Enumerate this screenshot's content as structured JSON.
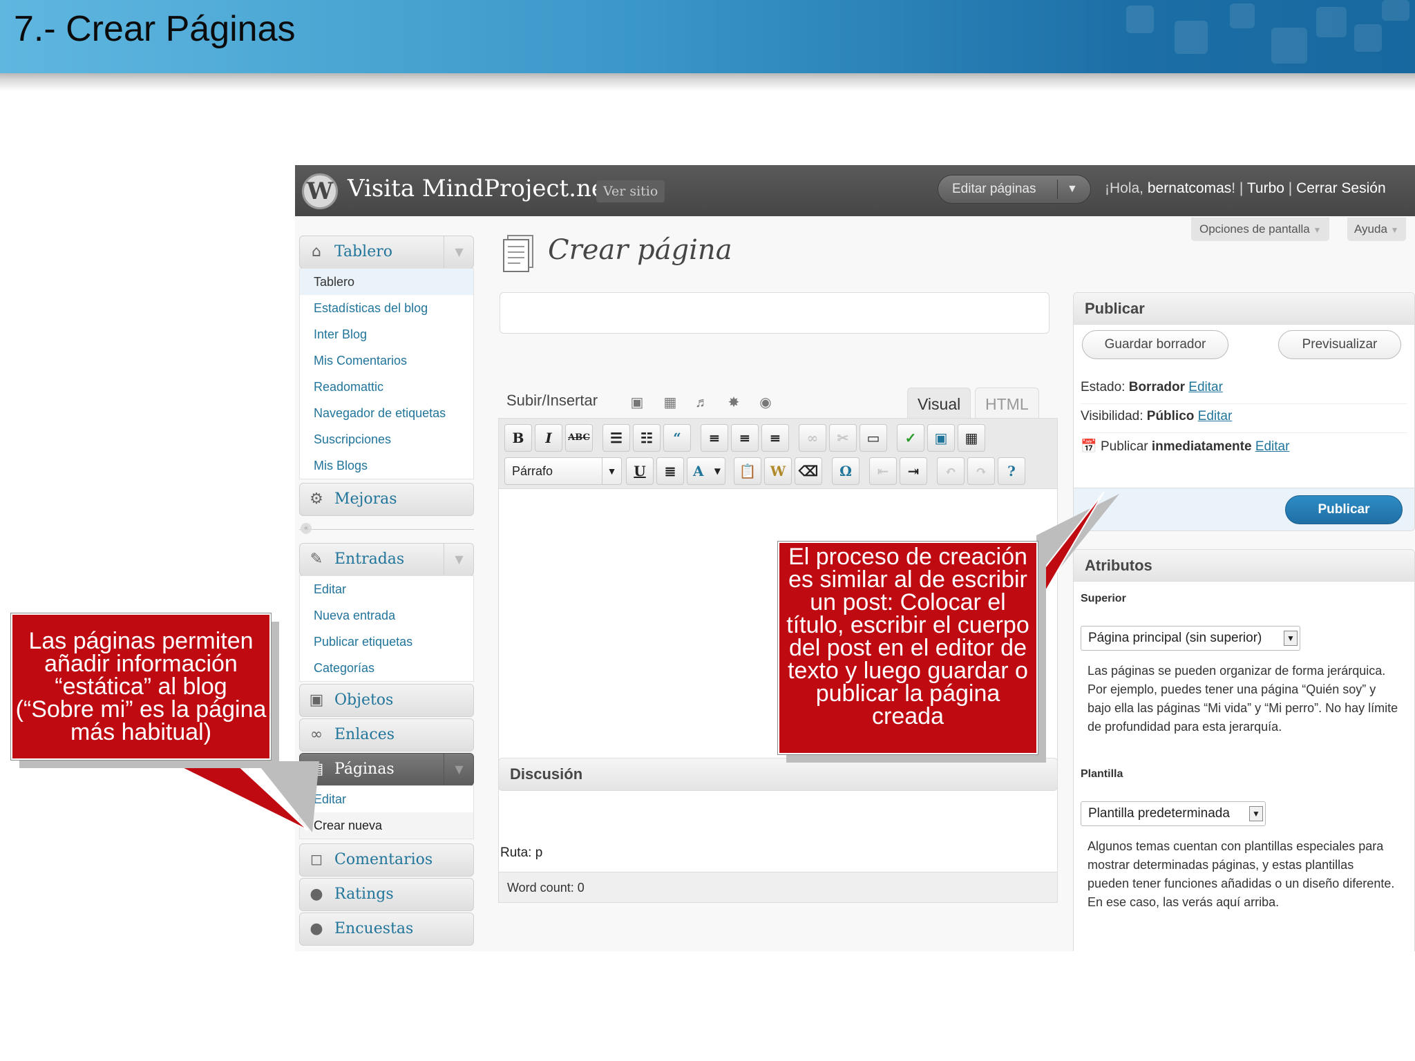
{
  "slide": {
    "title": "7.- Crear Páginas"
  },
  "adminbar": {
    "site_name": "Visita MindProject.net",
    "view_site": "Ver sitio",
    "edit_pages": "Editar páginas",
    "greeting_prefix": "¡Hola, ",
    "user": "bernatcomas",
    "greeting_suffix": "! | ",
    "turbo": "Turbo",
    "sep": " | ",
    "logout": "Cerrar Sesión"
  },
  "screen_options": "Opciones de pantalla",
  "help": "Ayuda",
  "sidebar": {
    "dashboard": {
      "label": "Tablero",
      "items": [
        "Tablero",
        "Estadísticas del blog",
        "Inter Blog",
        "Mis Comentarios",
        "Readomattic",
        "Navegador de etiquetas",
        "Suscripciones",
        "Mis Blogs"
      ]
    },
    "upgrades": "Mejoras",
    "posts": {
      "label": "Entradas",
      "items": [
        "Editar",
        "Nueva entrada",
        "Publicar etiquetas",
        "Categorías"
      ]
    },
    "media": "Objetos",
    "links": "Enlaces",
    "pages": {
      "label": "Páginas",
      "items": [
        "Editar",
        "Crear nueva"
      ]
    },
    "comments": "Comentarios",
    "ratings": "Ratings",
    "polls": "Encuestas"
  },
  "main": {
    "heading": "Crear página",
    "upload_insert": "Subir/Insertar",
    "tab_visual": "Visual",
    "tab_html": "HTML",
    "format_select": "Párrafo",
    "path": "Ruta: p",
    "word_count": "Word count: 0",
    "discussion": "Discusión"
  },
  "publish": {
    "title": "Publicar",
    "save_draft": "Guardar borrador",
    "preview": "Previsualizar",
    "status_label": "Estado: ",
    "status_value": "Borrador",
    "visibility_label": "Visibilidad: ",
    "visibility_value": "Público",
    "publish_label": "Publicar ",
    "publish_value": "inmediatamente",
    "edit": "Editar",
    "publish_button": "Publicar"
  },
  "attributes": {
    "title": "Atributos",
    "parent_label": "Superior",
    "parent_value": "Página principal (sin superior)",
    "parent_help": "Las páginas se pueden organizar de forma jerárquica. Por ejemplo, puedes tener una página “Quién soy” y bajo ella las páginas “Mi vida” y “Mi perro”. No hay límite de profundidad para esta jerarquía.",
    "template_label": "Plantilla",
    "template_value": "Plantilla predeterminada",
    "template_help": "Algunos temas cuentan con plantillas especiales para mostrar determinadas páginas, y estas plantillas pueden tener funciones añadidas o un diseño diferente. En ese caso, las verás aquí arriba."
  },
  "callouts": {
    "left": "Las páginas permiten añadir información “estática” al blog (“Sobre mi” es la página más habitual)",
    "right": "El proceso de creación es similar al de escribir un post: Colocar el título, escribir el cuerpo del post en el editor de texto y luego guardar o publicar la página creada"
  },
  "colors": {
    "link": "#21759b",
    "callout": "#c00a12",
    "adminbar": "#464646",
    "publish_button": "#2583bd"
  }
}
